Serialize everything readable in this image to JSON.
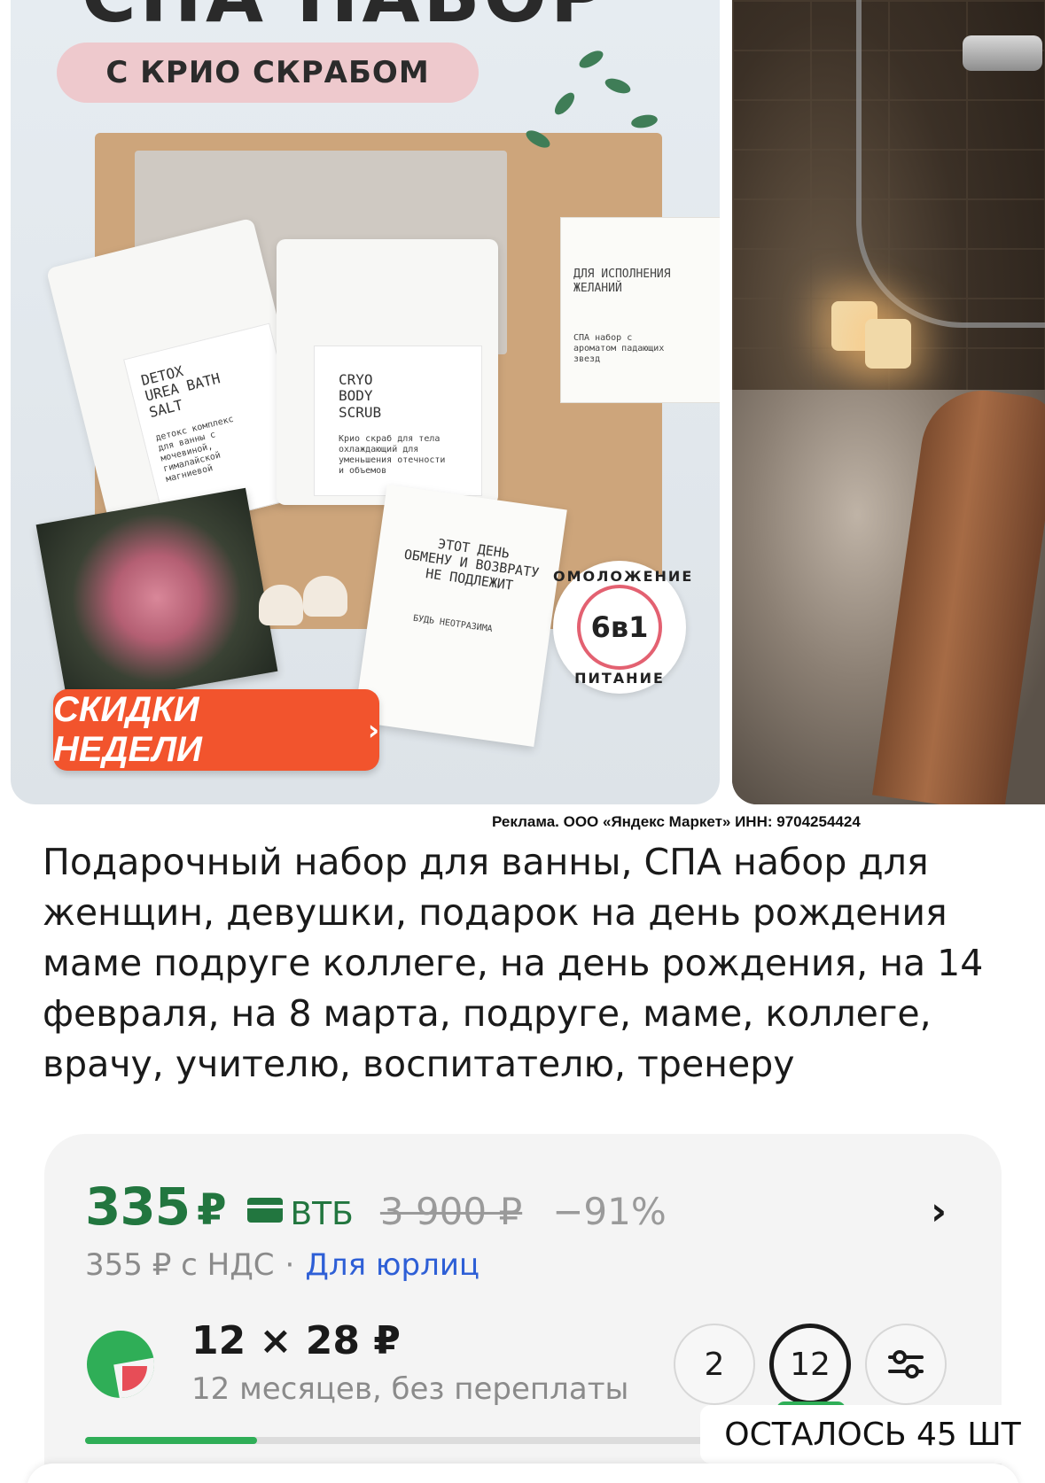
{
  "gallery": {
    "main_slide": {
      "headline": "СПА НАБОР",
      "subtitle": "С КРИО СКРАБОМ",
      "pouch_left_label": "DETOX\nUREA BATH\nSALT",
      "pouch_left_small": "детокс комплекс\nдля ванны с\nмочевиной,\nгималайской\nмагниевой",
      "pouch_right_label": "CRYO\nBODY\nSCRUB",
      "pouch_right_small": "Крио скраб для тела\nохлаждающий для\nуменьшения отечности\nи объемов",
      "wish_card_title": "ДЛЯ ИСПОЛНЕНИЯ\nЖЕЛАНИЙ",
      "wish_card_text": "СПА набор с\nароматом падающих\nзвезд",
      "postcard_text": "ЭТОТ ДЕНЬ\nОБМЕНУ И ВОЗВРАТУ\nНЕ ПОДЛЕЖИТ",
      "postcard_small": "БУДЬ НЕОТРАЗИМА",
      "badge_top": "ОМОЛОЖЕНИЕ",
      "badge_center": "6в1",
      "badge_bottom": "ПИТАНИЕ",
      "promo_button": "СКИДКИ НЕДЕЛИ",
      "promo_chevron": "›"
    }
  },
  "ad_disclaimer": "Реклама. ООО «Яндекс Маркет» ИНН: 9704254424",
  "product_title": "Подарочный набор для ванны, СПА набор для женщин, девушки, подарок на день рождения маме подруге коллеге, на день рождения, на 14 февраля, на 8 марта, подруге, маме, коллеге, врачу, учителю, воспитателю, тренеру",
  "price": {
    "current": "335",
    "currency": "₽",
    "bank": "ВТБ",
    "old": "3 900 ₽",
    "discount": "−91%",
    "vat_text": "355 ₽ с НДС",
    "separator": "·",
    "legal_link": "Для юрлиц",
    "chevron": "›"
  },
  "installment": {
    "amount": "12 × 28 ₽",
    "subtitle": "12 месяцев, без переплаты",
    "options": [
      "2",
      "12"
    ],
    "selected": "12",
    "progress_fraction": 0.22
  },
  "stock": "ОСТАЛОСЬ 45 ШТ",
  "colors": {
    "price_green": "#22763f",
    "accent_green": "#2fae57",
    "promo_orange": "#f2542d",
    "link_blue": "#2e5fd6"
  },
  "icons": {
    "bank_card": "card-icon",
    "split": "split-pay-icon",
    "filter": "sliders-icon",
    "chevron": "chevron-right-icon"
  }
}
